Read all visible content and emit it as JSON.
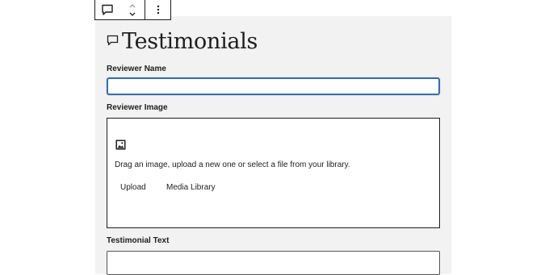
{
  "toolbar": {
    "block_type_icon": "speech-bubble-icon",
    "move_up_icon": "chevron-up-icon",
    "move_down_icon": "chevron-down-icon",
    "more_icon": "more-vertical-icon"
  },
  "block": {
    "title": "Testimonials",
    "title_icon": "speech-bubble-icon",
    "fields": {
      "reviewer_name_label": "Reviewer Name",
      "reviewer_name_value": "",
      "reviewer_image_label": "Reviewer Image",
      "image_icon": "image-icon",
      "image_instructions": "Drag an image, upload a new one or select a file from your library.",
      "upload_label": "Upload",
      "media_library_label": "Media Library",
      "testimonial_text_label": "Testimonial Text"
    }
  },
  "colors": {
    "focus_border": "#3a6ea5",
    "block_bg": "#f2f2f2",
    "text": "#1e1e1e"
  }
}
